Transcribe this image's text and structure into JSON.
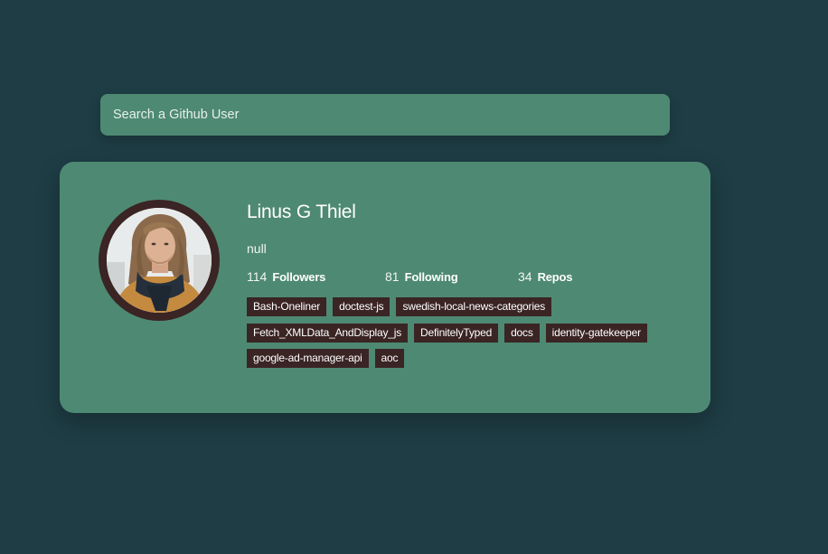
{
  "search": {
    "placeholder": "Search a Github User",
    "value": ""
  },
  "profile": {
    "name": "Linus G Thiel",
    "bio": "null",
    "stats": {
      "followers_count": "114",
      "followers_label": "Followers",
      "following_count": "81",
      "following_label": "Following",
      "repos_count": "34",
      "repos_label": "Repos"
    },
    "repos": [
      "Bash-Oneliner",
      "doctest-js",
      "swedish-local-news-categories",
      "Fetch_XMLData_AndDisplay_js",
      "DefinitelyTyped",
      "docs",
      "identity-gatekeeper",
      "google-ad-manager-api",
      "aoc"
    ]
  },
  "colors": {
    "background": "#1e3d44",
    "card": "#4e8973",
    "tag": "#3a2424",
    "text": "#ffffff"
  }
}
